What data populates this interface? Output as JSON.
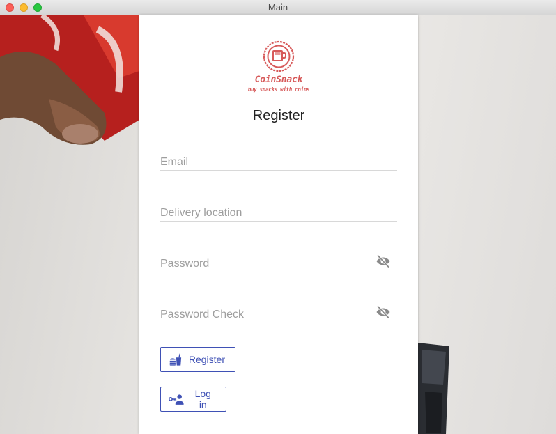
{
  "window": {
    "title": "Main"
  },
  "brand": {
    "name": "CoinSnack",
    "tagline": "buy snacks with coins",
    "color": "#d75a5a"
  },
  "form": {
    "heading": "Register",
    "fields": {
      "email": {
        "placeholder": "Email",
        "value": ""
      },
      "delivery": {
        "placeholder": "Delivery location",
        "value": ""
      },
      "password": {
        "placeholder": "Password",
        "value": "",
        "icon": "visibility-off-icon"
      },
      "password_check": {
        "placeholder": "Password Check",
        "value": "",
        "icon": "visibility-off-icon"
      }
    },
    "buttons": {
      "register": {
        "label": "Register",
        "icon": "fastfood-icon"
      },
      "login": {
        "label": "Log in",
        "icon": "person-key-icon"
      }
    }
  },
  "colors": {
    "accent": "#3f51b5",
    "card": "#ffffff"
  }
}
